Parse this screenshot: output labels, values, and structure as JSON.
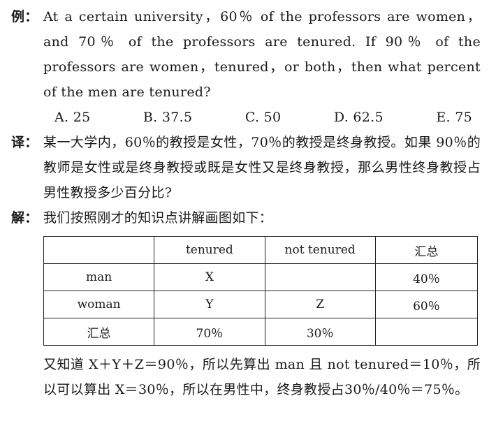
{
  "example": {
    "tag": "例：",
    "question": "At a certain university，60％ of the professors are women，and 70％ of the professors are tenured. If 90％ of the professors are women，tenured，or both，then what percent of the men are tenured?",
    "options": [
      "A. 25",
      "B. 37.5",
      "C. 50",
      "D. 62.5",
      "E. 75"
    ]
  },
  "translation": {
    "tag": "译：",
    "text": "某一大学内，60％的教授是女性，70％的教授是终身教授。如果 90％的教师是女性或是终身教授或既是女性又是终身教授，那么男性终身教授占男性教授多少百分比?"
  },
  "solution": {
    "tag": "解：",
    "intro": "我们按照刚才的知识点讲解画图如下：",
    "table": {
      "header": [
        "",
        "tenured",
        "not tenured",
        "汇总"
      ],
      "rows": [
        [
          "man",
          "X",
          "",
          "40％"
        ],
        [
          "woman",
          "Y",
          "Z",
          "60％"
        ],
        [
          "汇总",
          "70％",
          "30％",
          ""
        ]
      ]
    },
    "conclusion": "又知道 X＋Y＋Z＝90％，所以先算出 man 且 not tenured＝10％，所以可以算出 X＝30％，所以在男性中，终身教授占30％/40％＝75％。"
  }
}
